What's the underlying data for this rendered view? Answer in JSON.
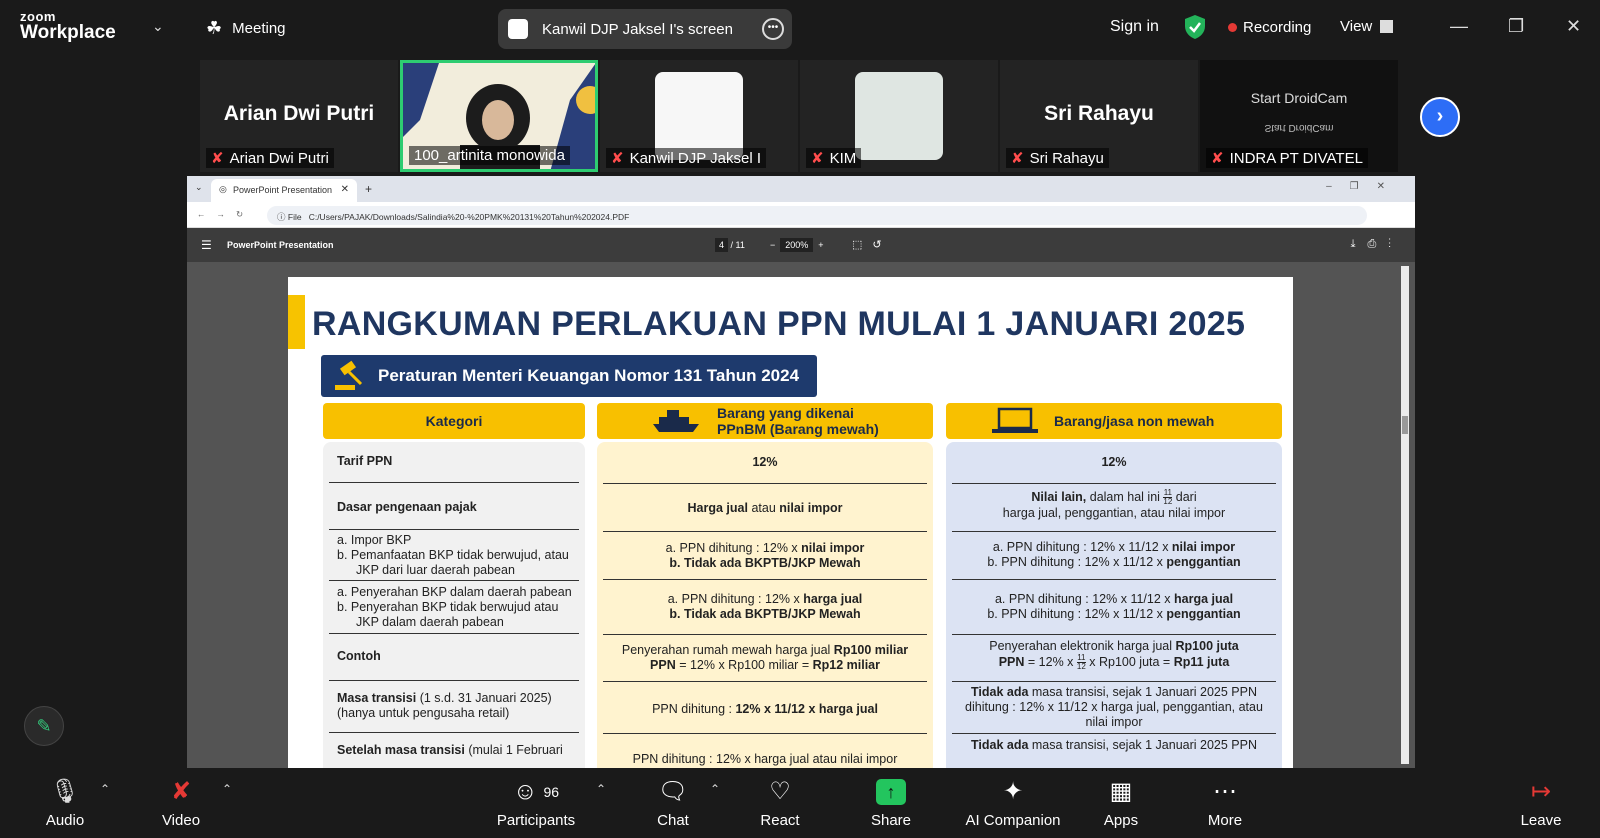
{
  "topbar": {
    "logo_line1": "zoom",
    "logo_line2": "Workplace",
    "meeting_label": "Meeting",
    "share_title": "Kanwil DJP Jaksel I's screen",
    "signin": "Sign in",
    "recording": "Recording",
    "view": "View",
    "accent": "#2d6df6"
  },
  "gallery": [
    {
      "bigname": "Arian Dwi Putri",
      "label": "Arian Dwi Putri"
    },
    {
      "bigname": "",
      "label": "100_artinita monowida"
    },
    {
      "bigname": "",
      "label": "Kanwil DJP Jaksel I"
    },
    {
      "bigname": "",
      "label": "KIM"
    },
    {
      "bigname": "Sri Rahayu",
      "label": "Sri Rahayu"
    },
    {
      "bigname": "Start DroidCam",
      "label": "INDRA PT DIVATEL"
    }
  ],
  "browser": {
    "tab_title": "PowerPoint Presentation",
    "url_prefix": "File",
    "url": "C:/Users/PAJAK/Downloads/Salindia%20-%20PMK%20131%20Tahun%202024.PDF",
    "pdf_title": "PowerPoint Presentation",
    "page_current": "4",
    "page_total": "/ 11",
    "zoom": "200%"
  },
  "slide": {
    "title": "RANGKUMAN PERLAKUAN PPN MULAI 1 JANUARI 2025",
    "regulation": "Peraturan Menteri Keuangan Nomor 131 Tahun 2024",
    "headers": {
      "kategori": "Kategori",
      "mewah_l1": "Barang yang dikenai",
      "mewah_l2": "PPnBM (Barang mewah)",
      "nonmewah": "Barang/jasa non mewah"
    },
    "kategori": {
      "tarif": "Tarif PPN",
      "dasar": "Dasar pengenaan pajak",
      "impor_a": "a.  Impor BKP",
      "impor_b": "b.  Pemanfaatan BKP tidak berwujud, atau",
      "impor_b2": "JKP dari luar daerah pabean",
      "penyerahan_a": "a.  Penyerahan BKP dalam daerah pabean",
      "penyerahan_b": "b.  Penyerahan BKP tidak berwujud atau",
      "penyerahan_b2": "JKP dalam daerah pabean",
      "contoh": "Contoh",
      "masa_bold": "Masa transisi",
      "masa_rest": " (1 s.d. 31 Januari 2025)",
      "masa_l2": "(hanya untuk pengusaha retail)",
      "setelah_bold": "Setelah masa transisi",
      "setelah_rest": " (mulai 1 Februari"
    },
    "mewah": {
      "tarif": "12%",
      "dasar_b1": "Harga jual",
      "dasar_mid": " atau ",
      "dasar_b2": "nilai impor",
      "impor_a": "a.  PPN dihitung : 12% x ",
      "impor_a_b": "nilai impor",
      "impor_b": "b.  Tidak ada BKPTB/JKP Mewah",
      "pen_a": "a.  PPN dihitung : 12% x ",
      "pen_a_b": "harga jual",
      "pen_b": "b.  Tidak ada BKPTB/JKP Mewah",
      "contoh_l1": "Penyerahan rumah mewah harga jual ",
      "contoh_l1_b": "Rp100 miliar",
      "contoh_l2a": "PPN",
      "contoh_l2b": " = 12% x Rp100 miliar = ",
      "contoh_l2c": "Rp12 miliar",
      "masa_a": "PPN dihitung : ",
      "masa_b": "12% x 11/12 x harga jual",
      "setelah": "PPN dihitung : 12% x harga jual atau nilai impor"
    },
    "nonmewah": {
      "tarif": "12%",
      "dasar_b": "Nilai lain,",
      "dasar_rest": " dalam hal ini ",
      "frac_num": "11",
      "frac_den": "12",
      "dasar_after": " dari",
      "dasar_l2": "harga jual, penggantian, atau nilai impor",
      "impor_a": "a.  PPN dihitung : 12% x 11/12 x ",
      "impor_a_b": "nilai impor",
      "impor_b": "b.  PPN dihitung : 12% x 11/12 x ",
      "impor_b_b": "penggantian",
      "pen_a": "a.  PPN dihitung : 12% x 11/12 x ",
      "pen_a_b": "harga jual",
      "pen_b": "b.  PPN dihitung : 12% x 11/12 x ",
      "pen_b_b": "penggantian",
      "contoh_l1": "Penyerahan elektronik harga jual ",
      "contoh_l1_b": "Rp100 juta",
      "contoh_l2a": "PPN",
      "contoh_l2b": " = 12% x ",
      "contoh_l2c": " x Rp100 juta = ",
      "contoh_l2d": "Rp11 juta",
      "masa_b": "Tidak ada",
      "masa_rest": " masa transisi, sejak 1 Januari 2025 PPN",
      "masa_l2": "dihitung : 12% x 11/12 x harga jual, penggantian, atau",
      "masa_l3": "nilai impor",
      "setelah_b": "Tidak ada",
      "setelah_rest": " masa transisi, sejak 1 Januari 2025 PPN"
    }
  },
  "toolbar": {
    "audio": "Audio",
    "video": "Video",
    "participants": "Participants",
    "participants_count": "96",
    "chat": "Chat",
    "react": "React",
    "share": "Share",
    "ai": "AI Companion",
    "apps": "Apps",
    "more": "More",
    "leave": "Leave"
  }
}
